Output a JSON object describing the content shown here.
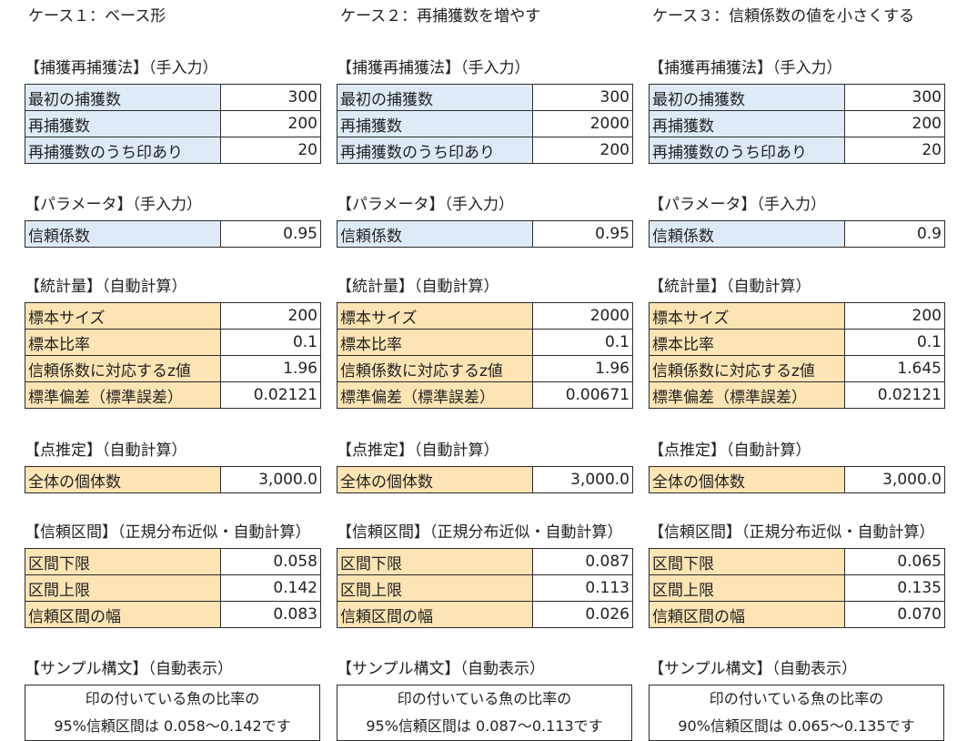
{
  "cases": [
    {
      "title": "ケース１：ベース形",
      "capture_title": "【捕獲再捕獲法】（手入力）",
      "capture": [
        [
          "最初の捕獲数",
          "300"
        ],
        [
          "再捕獲数",
          "200"
        ],
        [
          "再捕獲数のうち印あり",
          "20"
        ]
      ],
      "param_title": "【パラメータ】（手入力）",
      "param": [
        [
          "信頼係数",
          "0.95"
        ]
      ],
      "stats_title": "【統計量】（自動計算）",
      "stats": [
        [
          "標本サイズ",
          "200"
        ],
        [
          "標本比率",
          "0.1"
        ],
        [
          "信頼係数に対応するz値",
          "1.96"
        ],
        [
          "標準偏差（標準誤差）",
          "0.02121"
        ]
      ],
      "point_title": "【点推定】（自動計算）",
      "point": [
        [
          "全体の個体数",
          "3,000.0"
        ]
      ],
      "ci_title": "【信頼区間】（正規分布近似・自動計算）",
      "ci": [
        [
          "区間下限",
          "0.058"
        ],
        [
          "区間上限",
          "0.142"
        ],
        [
          "信頼区間の幅",
          "0.083"
        ]
      ],
      "sample_title": "【サンプル構文】（自動表示）",
      "sample_line1": "印の付いている魚の比率の",
      "sample_line2": "95%信頼区間は 0.058〜0.142です"
    },
    {
      "title": "ケース２：再捕獲数を増やす",
      "capture_title": "【捕獲再捕獲法】（手入力）",
      "capture": [
        [
          "最初の捕獲数",
          "300"
        ],
        [
          "再捕獲数",
          "2000"
        ],
        [
          "再捕獲数のうち印あり",
          "200"
        ]
      ],
      "param_title": "【パラメータ】（手入力）",
      "param": [
        [
          "信頼係数",
          "0.95"
        ]
      ],
      "stats_title": "【統計量】（自動計算）",
      "stats": [
        [
          "標本サイズ",
          "2000"
        ],
        [
          "標本比率",
          "0.1"
        ],
        [
          "信頼係数に対応するz値",
          "1.96"
        ],
        [
          "標準偏差（標準誤差）",
          "0.00671"
        ]
      ],
      "point_title": "【点推定】（自動計算）",
      "point": [
        [
          "全体の個体数",
          "3,000.0"
        ]
      ],
      "ci_title": "【信頼区間】（正規分布近似・自動計算）",
      "ci": [
        [
          "区間下限",
          "0.087"
        ],
        [
          "区間上限",
          "0.113"
        ],
        [
          "信頼区間の幅",
          "0.026"
        ]
      ],
      "sample_title": "【サンプル構文】（自動表示）",
      "sample_line1": "印の付いている魚の比率の",
      "sample_line2": "95%信頼区間は 0.087〜0.113です"
    },
    {
      "title": "ケース３：信頼係数の値を小さくする",
      "capture_title": "【捕獲再捕獲法】（手入力）",
      "capture": [
        [
          "最初の捕獲数",
          "300"
        ],
        [
          "再捕獲数",
          "200"
        ],
        [
          "再捕獲数のうち印あり",
          "20"
        ]
      ],
      "param_title": "【パラメータ】（手入力）",
      "param": [
        [
          "信頼係数",
          "0.9"
        ]
      ],
      "stats_title": "【統計量】（自動計算）",
      "stats": [
        [
          "標本サイズ",
          "200"
        ],
        [
          "標本比率",
          "0.1"
        ],
        [
          "信頼係数に対応するz値",
          "1.645"
        ],
        [
          "標準偏差（標準誤差）",
          "0.02121"
        ]
      ],
      "point_title": "【点推定】（自動計算）",
      "point": [
        [
          "全体の個体数",
          "3,000.0"
        ]
      ],
      "ci_title": "【信頼区間】（正規分布近似・自動計算）",
      "ci": [
        [
          "区間下限",
          "0.065"
        ],
        [
          "区間上限",
          "0.135"
        ],
        [
          "信頼区間の幅",
          "0.070"
        ]
      ],
      "sample_title": "【サンプル構文】（自動表示）",
      "sample_line1": "印の付いている魚の比率の",
      "sample_line2": "90%信頼区間は 0.065〜0.135です"
    }
  ],
  "colors": {
    "input_label_bg": "#deebf6",
    "calc_label_bg": "#fce4b4",
    "border": "#2b2b2b"
  }
}
